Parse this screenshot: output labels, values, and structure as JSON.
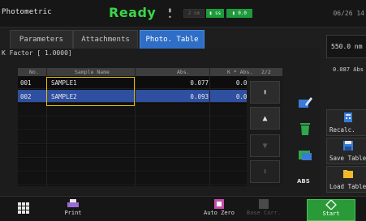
{
  "header": {
    "app_title": "Photometric",
    "status": "Ready",
    "lamp_label": "▮ •",
    "wavelength_label": "2 nm",
    "cell_label": "▮ ss",
    "temp_label": "▮ 0.0",
    "clock": "06/26 14"
  },
  "tabs": [
    {
      "label": "Parameters"
    },
    {
      "label": "Attachments"
    },
    {
      "label": "Photo. Table"
    }
  ],
  "kfactor": "K Factor [ 1.0000]",
  "table": {
    "columns": {
      "no": "No.",
      "name": "Sample Name",
      "abs": "Abs.",
      "kabs": "K * Abs.",
      "page": "2/2"
    },
    "rows": [
      {
        "no": "001",
        "name": "SAMPLE1",
        "abs": "0.077",
        "kabs": "0.0773"
      },
      {
        "no": "002",
        "name": "SAMPLE2",
        "abs": "0.093",
        "kabs": "0.0926"
      }
    ]
  },
  "right_panel": {
    "absorbance": "550.0 nm",
    "concentration": "0.087 Abs",
    "recalc": "Recalc.",
    "save_table": "Save Table",
    "load_table": "Load Table"
  },
  "scroll": {
    "top": "⬆",
    "up": "▲",
    "down": "▼",
    "bottom": "⬇"
  },
  "icons": {
    "abs_label": "ABS"
  },
  "bottom": {
    "print": "Print",
    "auto_zero": "Auto Zero",
    "baseline": "Base Corr.",
    "start": "Start"
  }
}
